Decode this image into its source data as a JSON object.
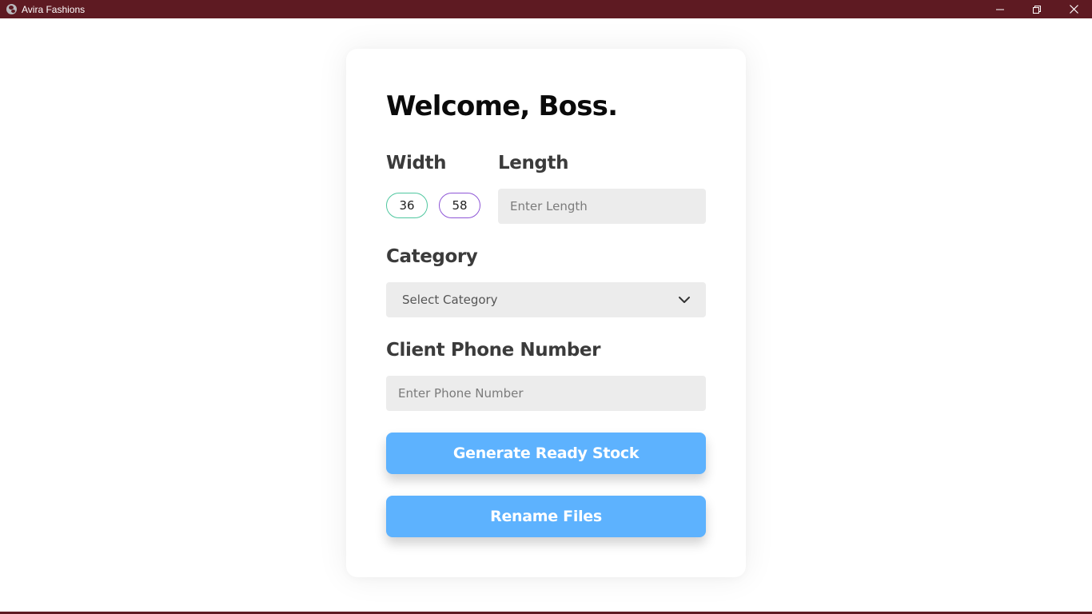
{
  "window": {
    "title": "Avira Fashions",
    "titlebar_color": "#5e1a22",
    "app_icon": "globe-icon",
    "controls": [
      "minimize-icon",
      "restore-icon",
      "close-icon"
    ]
  },
  "form": {
    "heading": "Welcome, Boss.",
    "width": {
      "label": "Width",
      "options": [
        {
          "value": "36",
          "border_color": "#4fc79f"
        },
        {
          "value": "58",
          "border_color": "#8e56d6"
        }
      ]
    },
    "length": {
      "label": "Length",
      "placeholder": "Enter Length",
      "value": ""
    },
    "category": {
      "label": "Category",
      "selected": "Select Category",
      "icon": "chevron-down-icon"
    },
    "phone": {
      "label": "Client Phone Number",
      "placeholder": "Enter Phone Number",
      "value": ""
    },
    "buttons": {
      "generate": "Generate Ready Stock",
      "rename": "Rename Files"
    },
    "accent_color": "#5db2fe"
  }
}
